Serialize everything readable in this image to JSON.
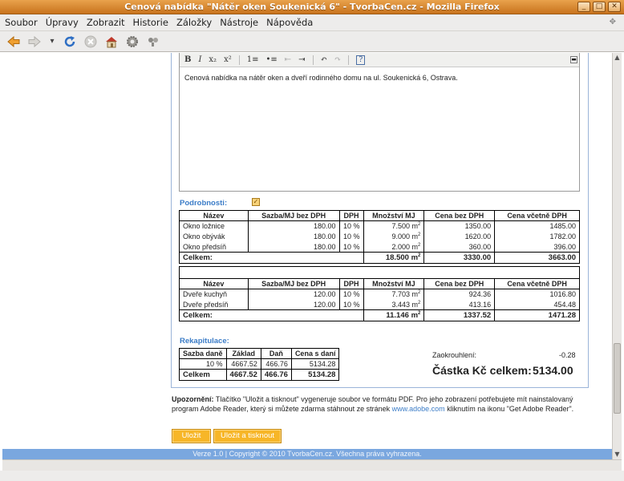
{
  "window": {
    "title": "Cenová nabídka \"Nátěr oken Soukenická 6\" - TvorbaCen.cz - Mozilla Firefox",
    "buttons": [
      "_",
      "□",
      "✕"
    ]
  },
  "menu": {
    "items": [
      "Soubor",
      "Úpravy",
      "Zobrazit",
      "Historie",
      "Záložky",
      "Nástroje",
      "Nápověda"
    ]
  },
  "toolbar": {
    "icons": [
      "back-arrow-icon",
      "forward-arrow-icon",
      "history-dropdown-icon",
      "reload-icon",
      "stop-icon",
      "home-icon",
      "settings-gear-icon",
      "extension-icon"
    ]
  },
  "editor": {
    "buttons": [
      "B",
      "I",
      "x₂",
      "x²",
      "1≡",
      "•≡",
      "⇤",
      "⇥",
      "↶",
      "↷",
      "?"
    ],
    "text": "Cenová nabídka na nátěr oken a dveří rodinného domu na ul. Soukenická 6, Ostrava."
  },
  "details": {
    "label": "Podrobnosti:",
    "checked": true
  },
  "columns": [
    "Název",
    "Sazba/MJ bez DPH",
    "DPH",
    "Množství MJ",
    "Cena bez DPH",
    "Cena včetně DPH"
  ],
  "windows_table": {
    "rows": [
      {
        "name": "Okno ložnice",
        "rate": "180.00",
        "vat": "10 %",
        "qty": "7.500",
        "unit": "m",
        "exp": "2",
        "net": "1350.00",
        "gross": "1485.00"
      },
      {
        "name": "Okno obývák",
        "rate": "180.00",
        "vat": "10 %",
        "qty": "9.000",
        "unit": "m",
        "exp": "2",
        "net": "1620.00",
        "gross": "1782.00"
      },
      {
        "name": "Okno předsíň",
        "rate": "180.00",
        "vat": "10 %",
        "qty": "2.000",
        "unit": "m",
        "exp": "2",
        "net": "360.00",
        "gross": "396.00"
      }
    ],
    "total": {
      "label": "Celkem:",
      "qty": "18.500",
      "unit": "m",
      "exp": "2",
      "net": "3330.00",
      "gross": "3663.00"
    }
  },
  "doors_table": {
    "rows": [
      {
        "name": "Dveře kuchyň",
        "rate": "120.00",
        "vat": "10 %",
        "qty": "7.703",
        "unit": "m",
        "exp": "2",
        "net": "924.36",
        "gross": "1016.80"
      },
      {
        "name": "Dveře předsíň",
        "rate": "120.00",
        "vat": "10 %",
        "qty": "3.443",
        "unit": "m",
        "exp": "2",
        "net": "413.16",
        "gross": "454.48"
      }
    ],
    "total": {
      "label": "Celkem:",
      "qty": "11.146",
      "unit": "m",
      "exp": "2",
      "net": "1337.52",
      "gross": "1471.28"
    }
  },
  "recap": {
    "label": "Rekapitulace:",
    "columns": [
      "Sazba daně",
      "Základ",
      "Daň",
      "Cena s daní"
    ],
    "row": {
      "rate": "10 %",
      "base": "4667.52",
      "tax": "466.76",
      "total": "5134.28"
    },
    "total": {
      "label": "Celkem",
      "base": "4667.52",
      "tax": "466.76",
      "total": "5134.28"
    }
  },
  "rounding": {
    "label": "Zaokrouhlení:",
    "value": "-0.28"
  },
  "grand_total": {
    "label": "Částka Kč celkem:",
    "value": "5134.00"
  },
  "warning": {
    "bold": "Upozornění:",
    "text1": " Tlačítko \"Uložit a tisknout\" vygeneruje soubor ve formátu PDF. Pro jeho zobrazení potřebujete mít nainstalovaný program Adobe Reader, který si můžete zdarma stáhnout ze stránek ",
    "link": "www.adobe.com",
    "text2": " kliknutím na ikonu \"Get Adobe Reader\"."
  },
  "buttons": {
    "save": "Uložit",
    "save_print": "Uložit a tisknout"
  },
  "footer": "Verze 1.0 | Copyright © 2010 TvorbaCen.cz. Všechna práva vyhrazena.",
  "colors": {
    "titlebar": "#d8862f",
    "accent": "#3b7cc7",
    "button": "#f7b628",
    "footer": "#7aa7df"
  }
}
